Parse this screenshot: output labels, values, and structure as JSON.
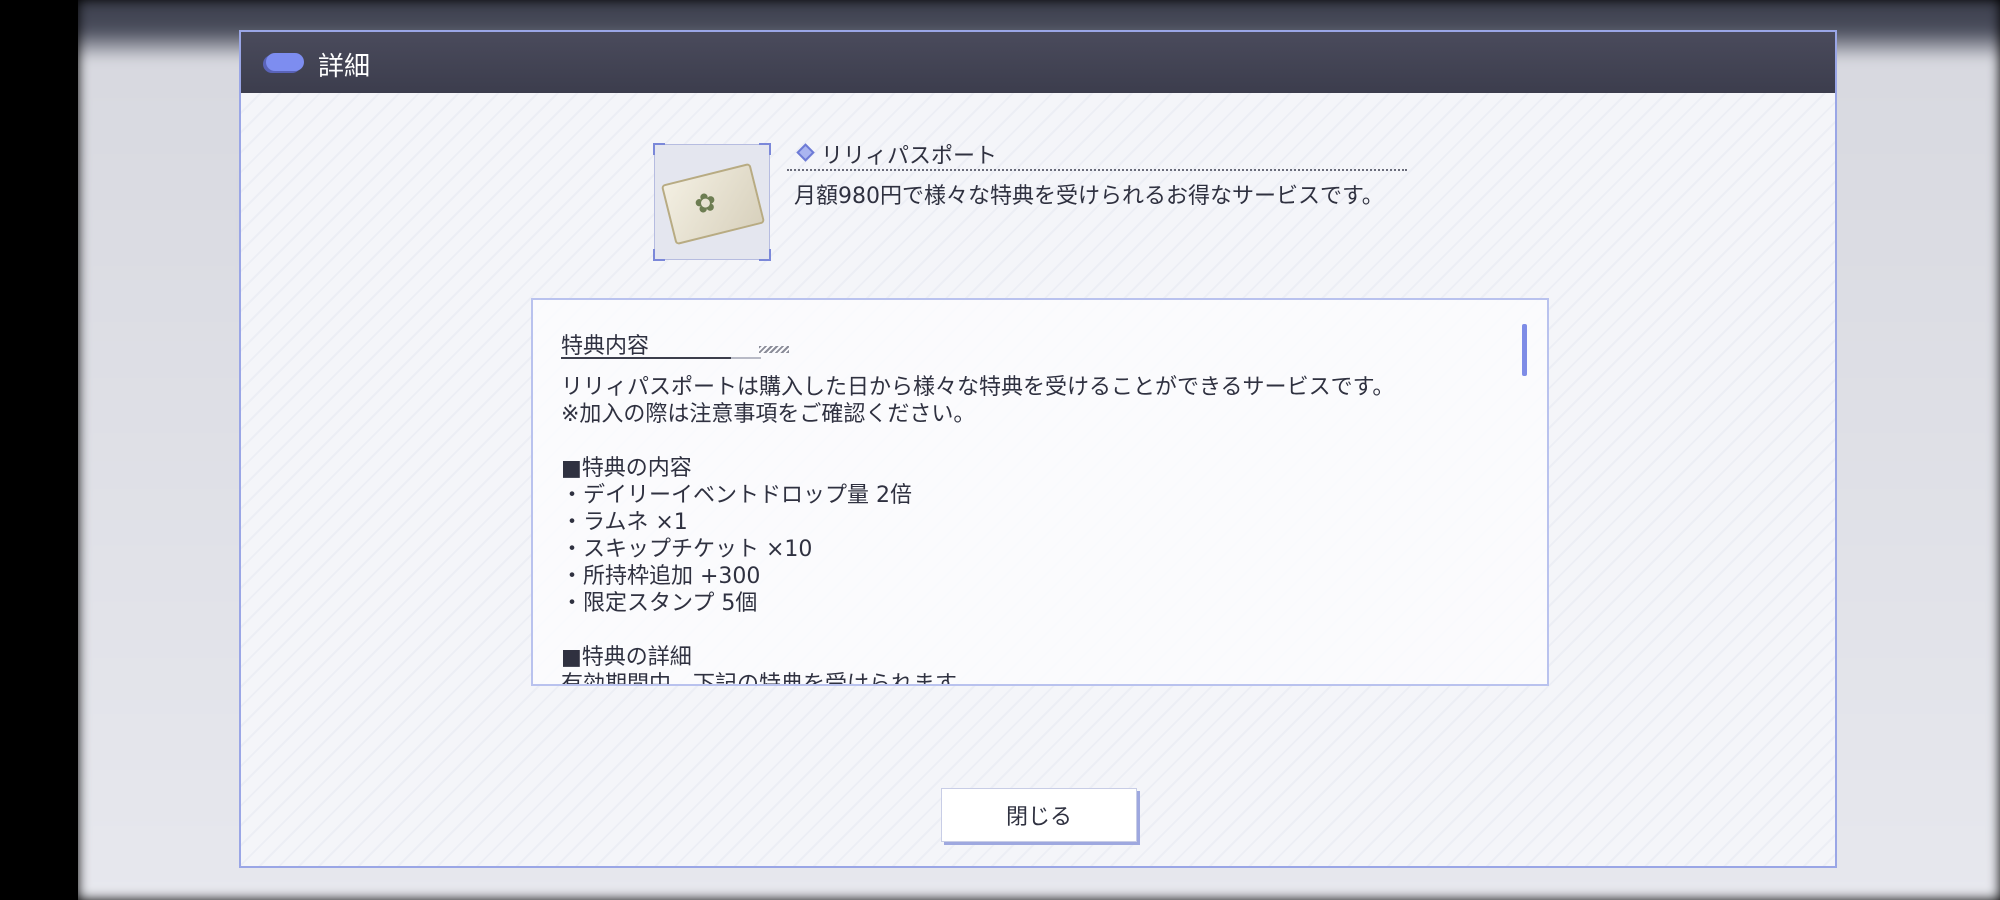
{
  "modal": {
    "title": "詳細",
    "close_label": "閉じる"
  },
  "item": {
    "icon": "diamond-icon",
    "name": "リリィパスポート",
    "description": "月額980円で様々な特典を受けられるお得なサービスです。",
    "thumbnail": "lily-passport-ticket-image"
  },
  "benefits": {
    "section_title": "特典内容",
    "lines": [
      "リリィパスポートは購入した日から様々な特典を受けることができるサービスです。",
      "※加入の際は注意事項をご確認ください。",
      "",
      "■特典の内容",
      "・デイリーイベントドロップ量 2倍",
      "・ラムネ ×1",
      "・スキップチケット ×10",
      "・所持枠追加 +300",
      "・限定スタンプ 5個",
      "",
      "■特典の詳細",
      "有効期間中、下記の特典を受けられます。"
    ]
  },
  "colors": {
    "accent": "#7d8df0",
    "header": "#3c3d4d",
    "border": "#9aa6e6"
  }
}
